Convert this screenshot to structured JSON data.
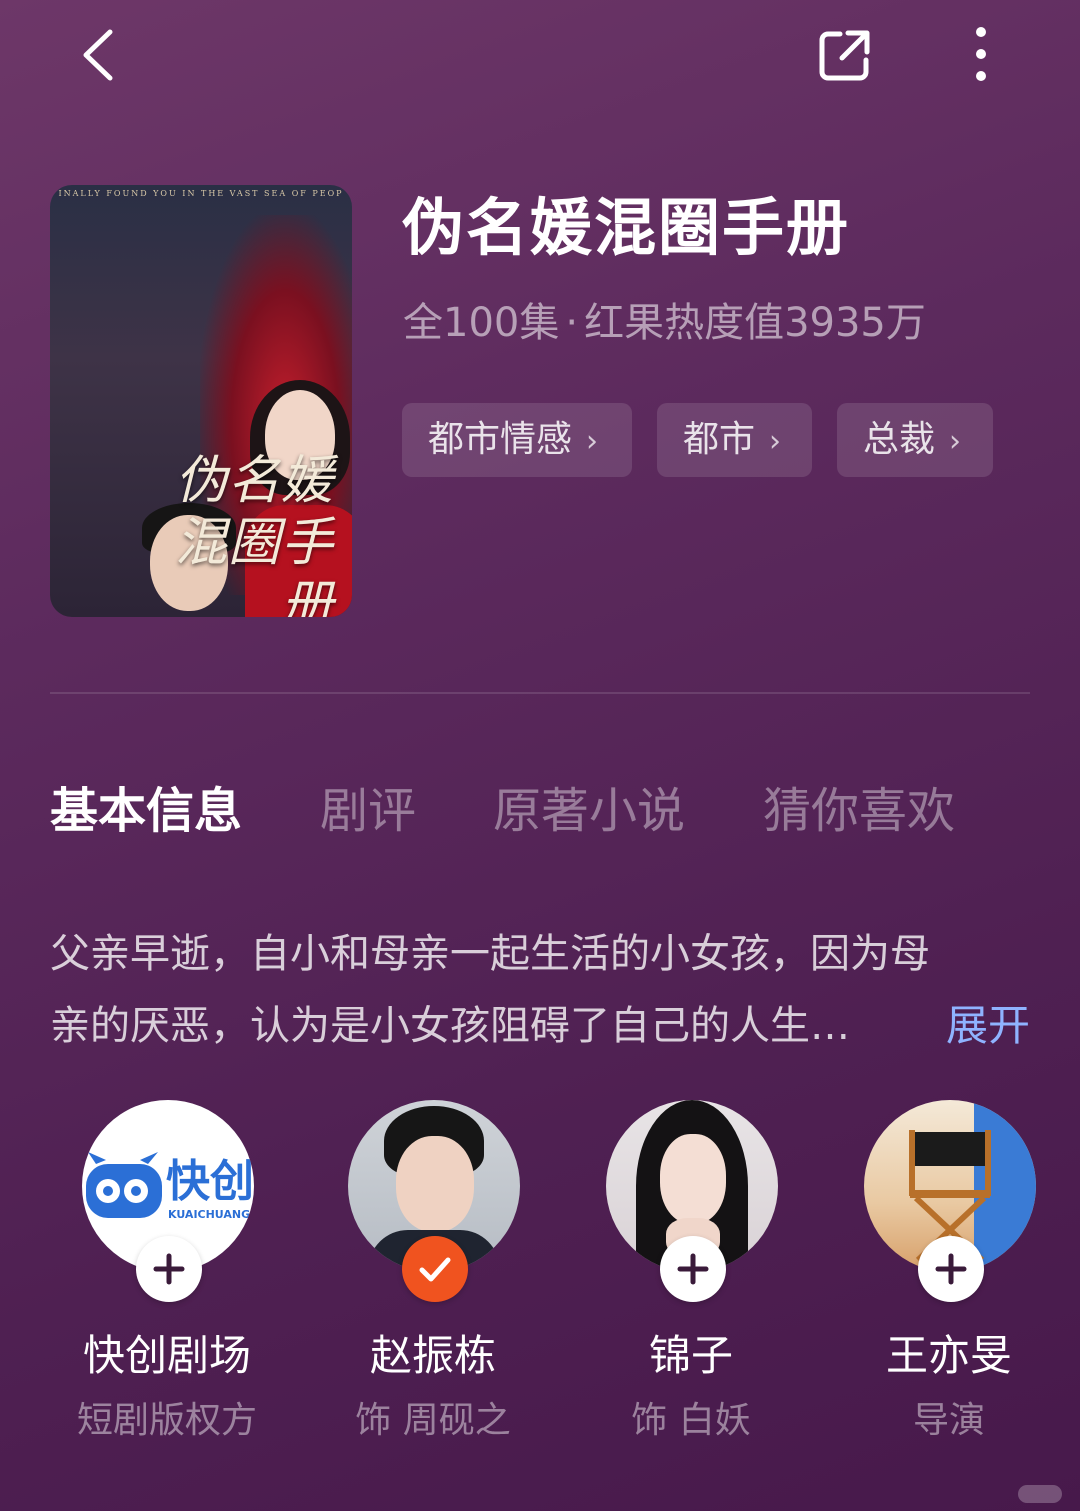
{
  "top_bar": {
    "back_icon": "chevron-left-icon",
    "share_icon": "share-external-icon",
    "more_icon": "more-vertical-icon"
  },
  "show": {
    "cover_tagline": "INALLY FOUND YOU IN THE VAST SEA OF PEOP",
    "cover_title": "伪名媛混圈手册",
    "title": "伪名媛混圈手册",
    "episodes": "全100集",
    "separator": "·",
    "heat": "红果热度值3935万",
    "tags": [
      "都市情感",
      "都市",
      "总裁"
    ]
  },
  "tabs": [
    "基本信息",
    "剧评",
    "原著小说",
    "猜你喜欢"
  ],
  "active_tab": "基本信息",
  "synopsis": {
    "line1": "父亲早逝，自小和母亲一起生活的小女孩，因为母",
    "line2": "亲的厌恶，认为是小女孩阻碍了自己的人生…",
    "expand_label": "展开"
  },
  "cast": [
    {
      "name": "快创剧场",
      "role": "短剧版权方",
      "followed": false,
      "logo_text": "快创",
      "logo_sub": "KUAICHUANG"
    },
    {
      "name": "赵振栋",
      "role": "饰 周砚之",
      "followed": true
    },
    {
      "name": "锦子",
      "role": "饰 白妖",
      "followed": false
    },
    {
      "name": "王亦旻",
      "role": "导演",
      "followed": false
    }
  ],
  "colors": {
    "background": "#5c2a5d",
    "accent_link": "#8fb3ff",
    "followed_badge": "#f0531f"
  }
}
